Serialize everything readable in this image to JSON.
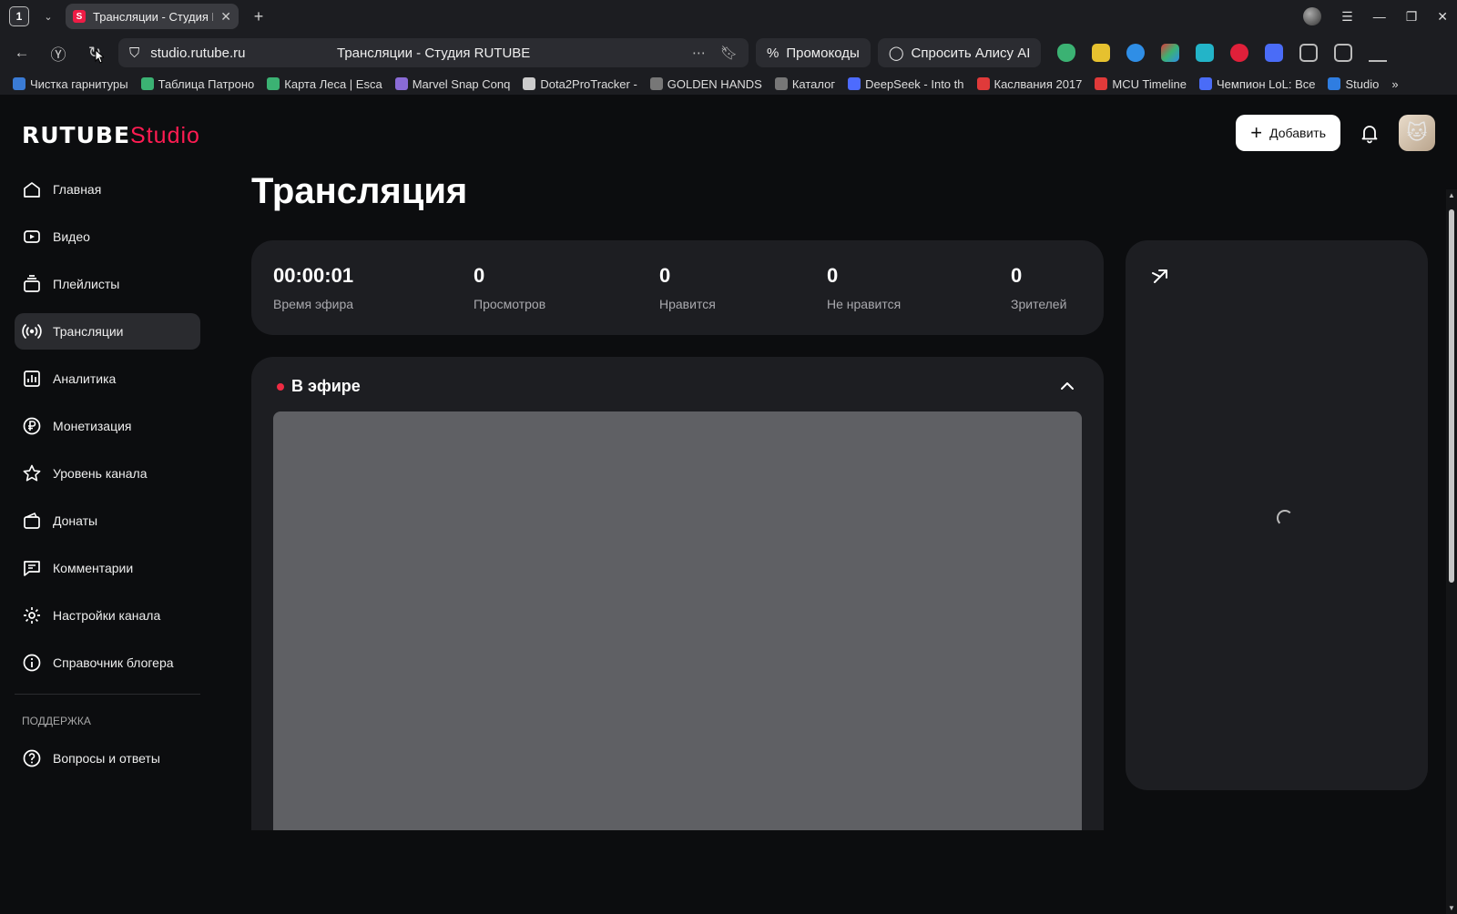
{
  "browser": {
    "tab_count": "1",
    "tab_title": "Трансляции - Студия R",
    "url": "studio.rutube.ru",
    "page_title": "Трансляции - Студия RUTUBE",
    "promo_label": "Промокоды",
    "alice_label": "Спросить Алису AI",
    "bookmarks": [
      {
        "label": "Чистка гарнитуры",
        "color": "#3a7bd5"
      },
      {
        "label": "Таблица Патроно",
        "color": "#3bb273"
      },
      {
        "label": "Карта Леса | Esca",
        "color": "#3bb273"
      },
      {
        "label": "Marvel Snap Conq",
        "color": "#8a6bd6"
      },
      {
        "label": "Dota2ProTracker -",
        "color": "#cccccc"
      },
      {
        "label": "GOLDEN HANDS",
        "color": "#777777"
      },
      {
        "label": "Каталог",
        "color": "#777777"
      },
      {
        "label": "DeepSeek - Into th",
        "color": "#4d6bfe"
      },
      {
        "label": "Каслвания 2017",
        "color": "#e03a3a"
      },
      {
        "label": "MCU Timeline",
        "color": "#e03a3a"
      },
      {
        "label": "Чемпион LoL: Все",
        "color": "#4a6cf7"
      },
      {
        "label": "Studio",
        "color": "#2f7de1"
      }
    ]
  },
  "app": {
    "logo_main": "RUTUBE",
    "logo_sub": "Studio",
    "add_button": "Добавить",
    "page_title": "Трансляция"
  },
  "sidebar": {
    "items": [
      {
        "label": "Главная",
        "icon": "home-icon"
      },
      {
        "label": "Видео",
        "icon": "video-icon"
      },
      {
        "label": "Плейлисты",
        "icon": "playlist-icon"
      },
      {
        "label": "Трансляции",
        "icon": "broadcast-icon",
        "active": true
      },
      {
        "label": "Аналитика",
        "icon": "analytics-icon"
      },
      {
        "label": "Монетизация",
        "icon": "ruble-icon"
      },
      {
        "label": "Уровень канала",
        "icon": "star-icon"
      },
      {
        "label": "Донаты",
        "icon": "wallet-icon"
      },
      {
        "label": "Комментарии",
        "icon": "comment-icon"
      },
      {
        "label": "Настройки канала",
        "icon": "gear-icon"
      },
      {
        "label": "Справочник блогера",
        "icon": "info-icon"
      }
    ],
    "support_heading": "ПОДДЕРЖКА",
    "support_items": [
      {
        "label": "Вопросы и ответы",
        "icon": "question-icon"
      }
    ]
  },
  "stats": [
    {
      "value": "00:00:01",
      "label": "Время эфира"
    },
    {
      "value": "0",
      "label": "Просмотров"
    },
    {
      "value": "0",
      "label": "Нравится"
    },
    {
      "value": "0",
      "label": "Не нравится"
    },
    {
      "value": "0",
      "label": "Зрителей"
    }
  ],
  "live": {
    "heading": "В эфире",
    "status_color": "#ee2b43"
  },
  "colors": {
    "brand": "#ff1c52",
    "background": "#0c0d0f",
    "card": "#1d1e22"
  }
}
